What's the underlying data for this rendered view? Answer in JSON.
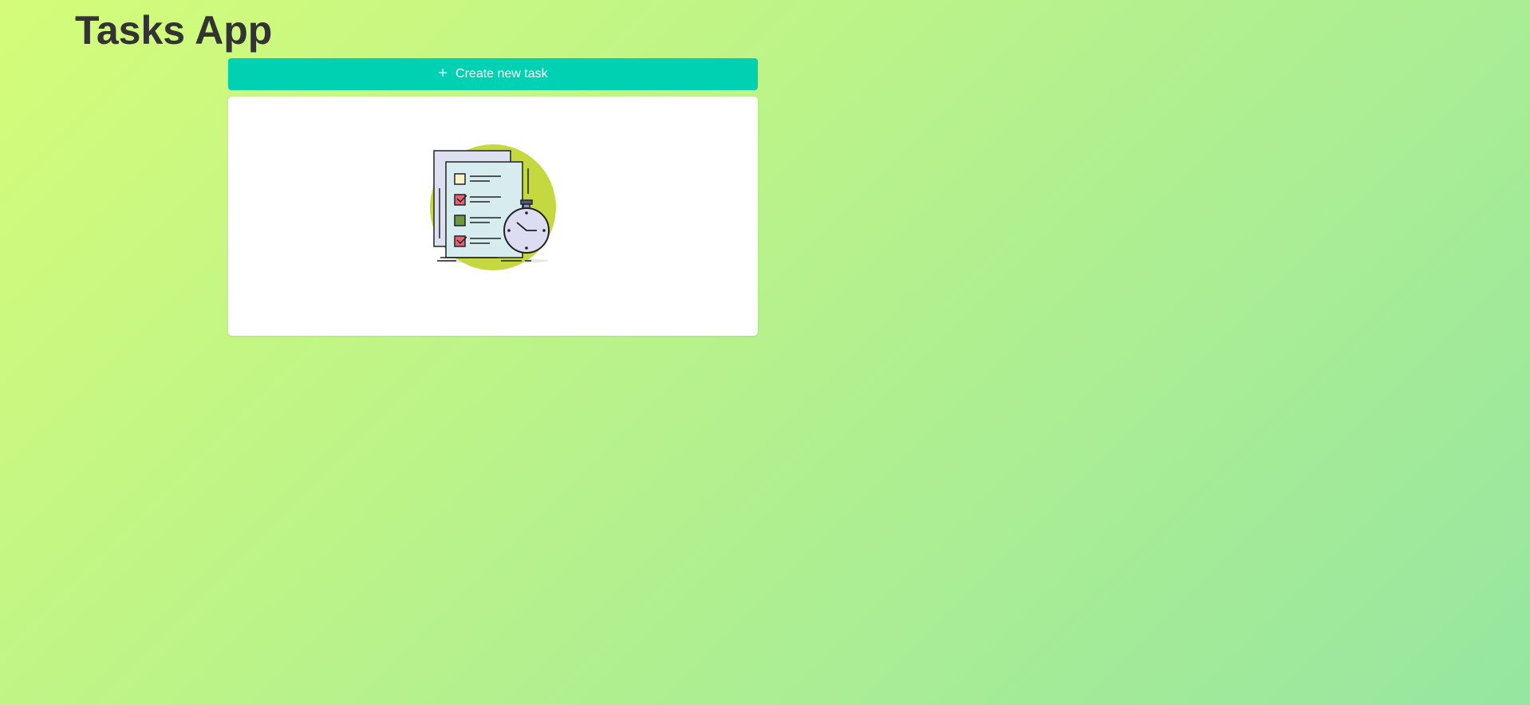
{
  "app": {
    "title": "Tasks App"
  },
  "toolbar": {
    "create_label": "Create new task",
    "create_icon": "plus-icon"
  },
  "empty_state": {
    "illustration": "task-checklist-stopwatch-illustration"
  },
  "colors": {
    "accent": "#00d1b2",
    "background_start": "#d4fc79",
    "background_end": "#96e6a1",
    "title": "#333333"
  }
}
